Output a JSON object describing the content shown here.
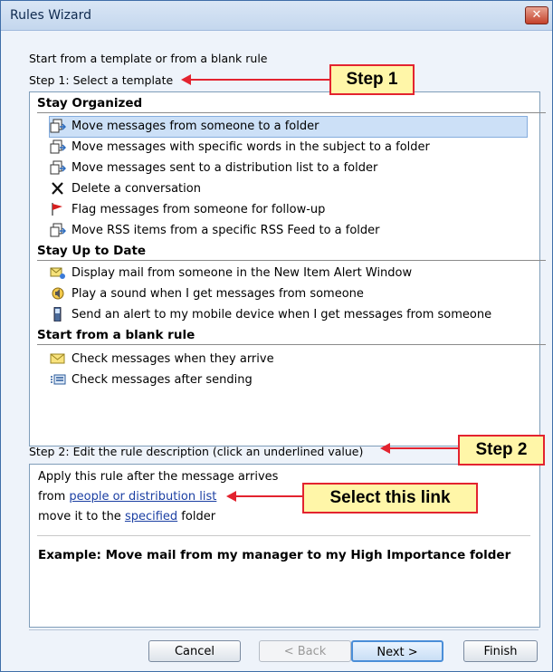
{
  "window": {
    "title": "Rules Wizard",
    "close_glyph": "✕"
  },
  "intro": "Start from a template or from a blank rule",
  "step1_label": "Step 1: Select a template",
  "groups": [
    {
      "header": "Stay Organized",
      "items": [
        {
          "label": "Move messages from someone to a folder",
          "icon": "move-to-folder-icon",
          "selected": true
        },
        {
          "label": "Move messages with specific words in the subject to a folder",
          "icon": "move-to-folder-icon"
        },
        {
          "label": "Move messages sent to a distribution list to a folder",
          "icon": "move-to-folder-icon"
        },
        {
          "label": "Delete a conversation",
          "icon": "delete-x-icon"
        },
        {
          "label": "Flag messages from someone for follow-up",
          "icon": "red-flag-icon"
        },
        {
          "label": "Move RSS items from a specific RSS Feed to a folder",
          "icon": "move-to-folder-icon"
        }
      ]
    },
    {
      "header": "Stay Up to Date",
      "items": [
        {
          "label": "Display mail from someone in the New Item Alert Window",
          "icon": "alert-window-icon"
        },
        {
          "label": "Play a sound when I get messages from someone",
          "icon": "speaker-icon"
        },
        {
          "label": "Send an alert to my mobile device when I get messages from someone",
          "icon": "mobile-phone-icon"
        }
      ]
    },
    {
      "header": "Start from a blank rule",
      "items": [
        {
          "label": "Check messages when they arrive",
          "icon": "envelope-icon"
        },
        {
          "label": "Check messages after sending",
          "icon": "sent-list-icon"
        }
      ]
    }
  ],
  "step2_label": "Step 2: Edit the rule description (click an underlined value)",
  "description": {
    "line1": "Apply this rule after the message arrives",
    "line2_prefix": "from ",
    "line2_link": "people or distribution list",
    "line3_prefix": "move it to the ",
    "line3_link": "specified",
    "line3_suffix": " folder",
    "example": "Example: Move mail from my manager to my High Importance folder"
  },
  "buttons": {
    "cancel": "Cancel",
    "back": "< Back",
    "next": "Next >",
    "finish": "Finish"
  },
  "callouts": {
    "step1": "Step 1",
    "step2": "Step 2",
    "select_link": "Select this link"
  },
  "colors": {
    "callout_fill": "#fff6a8",
    "callout_border": "#e3232f",
    "selection": "#cce0f7",
    "link": "#1b3fa3"
  }
}
